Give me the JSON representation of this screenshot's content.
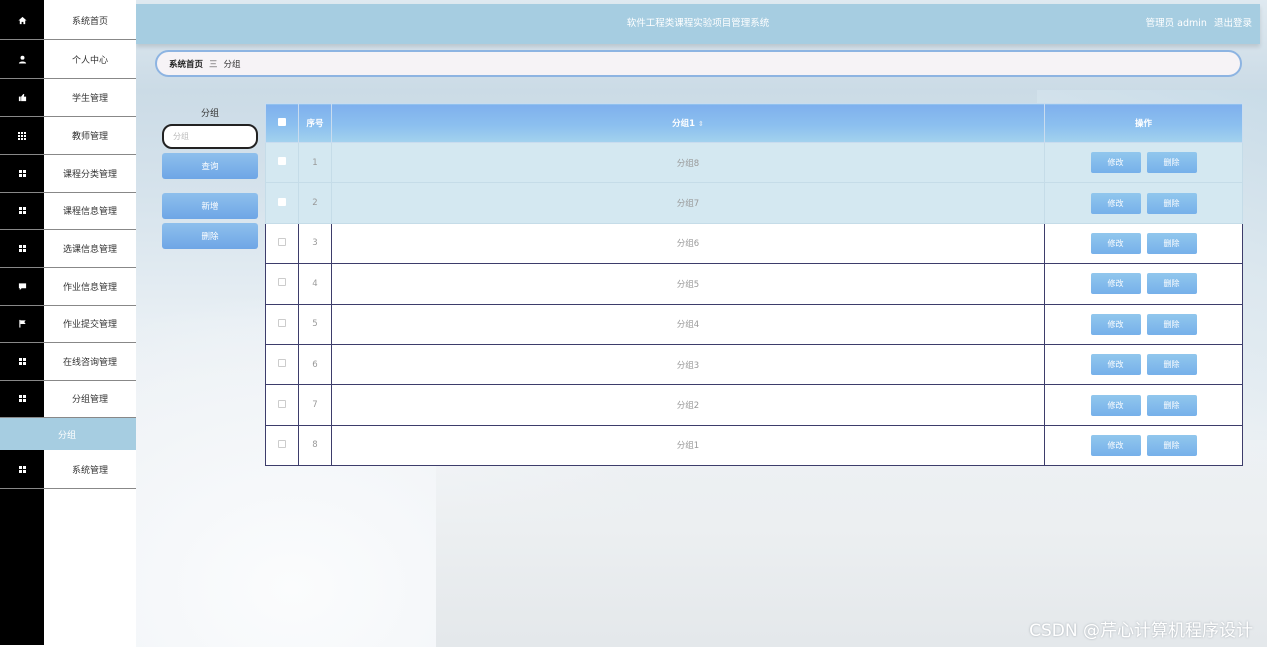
{
  "sidebar": {
    "items": [
      {
        "label": "系统首页",
        "icon": "home-icon"
      },
      {
        "label": "个人中心",
        "icon": "user-icon"
      },
      {
        "label": "学生管理",
        "icon": "thumb-icon"
      },
      {
        "label": "教师管理",
        "icon": "grid-icon"
      },
      {
        "label": "课程分类管理",
        "icon": "grid-icon"
      },
      {
        "label": "课程信息管理",
        "icon": "grid-icon"
      },
      {
        "label": "选课信息管理",
        "icon": "grid-icon"
      },
      {
        "label": "作业信息管理",
        "icon": "chat-icon"
      },
      {
        "label": "作业提交管理",
        "icon": "flag-icon"
      },
      {
        "label": "在线咨询管理",
        "icon": "grid-icon"
      },
      {
        "label": "分组管理",
        "icon": "grid-icon"
      }
    ],
    "active_sub": "分组",
    "last_item": {
      "label": "系统管理",
      "icon": "grid-icon"
    }
  },
  "header": {
    "title": "软件工程类课程实验项目管理系统",
    "user_label": "管理员 admin",
    "logout": "退出登录"
  },
  "breadcrumb": {
    "home": "系统首页",
    "sep": "三",
    "current": "分组"
  },
  "search": {
    "label": "分组",
    "placeholder": "分组",
    "query_button": "查询",
    "add_button": "新增",
    "delete_button": "删除"
  },
  "table": {
    "headers": {
      "index": "序号",
      "group": "分组1",
      "sort": "⇕",
      "actions": "操作"
    },
    "edit_label": "修改",
    "delete_label": "删除",
    "rows": [
      {
        "index": "1",
        "group": "分组8",
        "selected": true
      },
      {
        "index": "2",
        "group": "分组7",
        "selected": true
      },
      {
        "index": "3",
        "group": "分组6",
        "selected": false
      },
      {
        "index": "4",
        "group": "分组5",
        "selected": false
      },
      {
        "index": "5",
        "group": "分组4",
        "selected": false
      },
      {
        "index": "6",
        "group": "分组3",
        "selected": false
      },
      {
        "index": "7",
        "group": "分组2",
        "selected": false
      },
      {
        "index": "8",
        "group": "分组1",
        "selected": false
      }
    ]
  },
  "watermark": "CSDN @芹心计算机程序设计",
  "colors": {
    "header_bg": "#a6cde1",
    "button_blue": "#7fb5ea",
    "sidebar_icon_bg": "#000000"
  }
}
